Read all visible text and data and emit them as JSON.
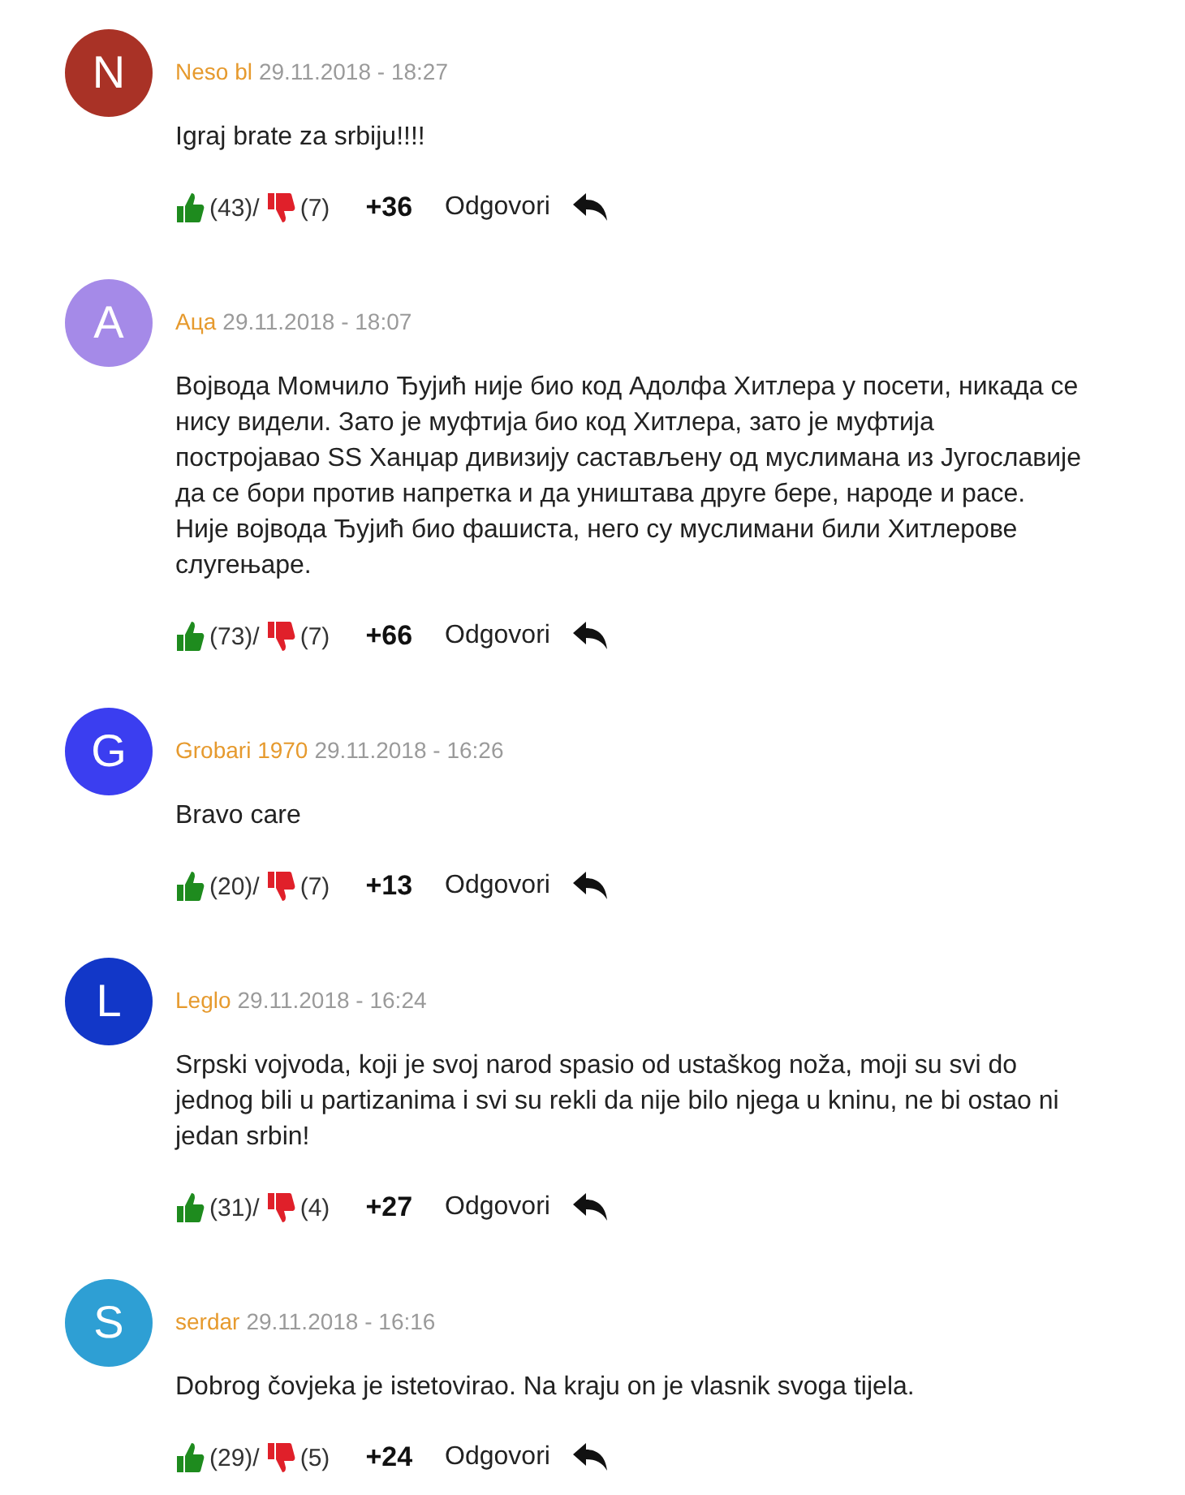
{
  "comments": [
    {
      "initial": "N",
      "color": "#a93226",
      "author": "Neso bl",
      "date": "29.11.2018 - 18:27",
      "text": "Igraj brate za srbiju!!!!",
      "likes": "(43)/",
      "dislikes": "(7)",
      "score": "+36",
      "reply": "Odgovori"
    },
    {
      "initial": "А",
      "color": "#a58ae8",
      "author": "Аца",
      "date": "29.11.2018 - 18:07",
      "text": "Војвода Момчило Ђујић није био код Адолфа Хитлера у посети, никада се нису видели. Зато је муфтија био код Хитлера, зато је муфтија постројавао SS Ханџар дивизију састављену од муслимана из Југославије да се бори против напретка и да уништава друге бере, народе и расе. Није војвода Ђујић био фашиста, него су муслимани били Хитлерове слугењаре.",
      "likes": "(73)/",
      "dislikes": "(7)",
      "score": "+66",
      "reply": "Odgovori"
    },
    {
      "initial": "G",
      "color": "#3b3ef0",
      "author": "Grobari 1970",
      "date": "29.11.2018 - 16:26",
      "text": "Bravo care",
      "likes": "(20)/",
      "dislikes": "(7)",
      "score": "+13",
      "reply": "Odgovori"
    },
    {
      "initial": "L",
      "color": "#1237c8",
      "author": "Leglo",
      "date": "29.11.2018 - 16:24",
      "text": "Srpski vojvoda, koji je svoj narod spasio od ustaškog noža, moji su svi do jednog bili u partizanima i svi su rekli da nije bilo njega u kninu, ne bi ostao ni jedan srbin!",
      "likes": "(31)/",
      "dislikes": "(4)",
      "score": "+27",
      "reply": "Odgovori"
    },
    {
      "initial": "S",
      "color": "#2e9fd4",
      "author": "serdar",
      "date": "29.11.2018 - 16:16",
      "text": "Dobrog čovjeka je istetovirao. Na kraju on je vlasnik svoga tijela.",
      "likes": "(29)/",
      "dislikes": "(5)",
      "score": "+24",
      "reply": "Odgovori"
    }
  ]
}
